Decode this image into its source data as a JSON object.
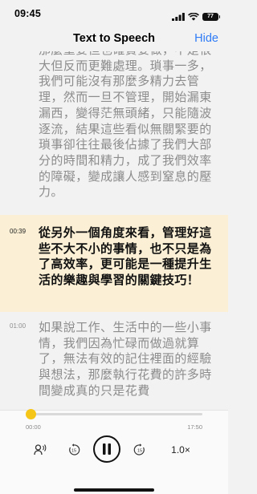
{
  "status": {
    "time": "09:45",
    "battery": "77"
  },
  "header": {
    "title": "Text to Speech",
    "hide_label": "Hide"
  },
  "segments": [
    {
      "time": "",
      "text": "那麼重要但也確實要做，不是很大但反而更難處理。瑣事一多，我們可能沒有那麼多精力去管理，然而一旦不管理，開始漏東漏西，變得茫無頭緒，只能隨波逐流，結果這些看似無關緊要的瑣事卻往往最後佔據了我們大部分的時間和精力，成了我們效率的障礙，變成讓人感到窒息的壓力。",
      "active": false
    },
    {
      "time": "00:39",
      "text": "從另外一個角度來看，管理好這些不大不小的事情，也不只是為了高效率，更可能是一種提升生活的樂趣與學習的關鍵技巧！",
      "active": true
    },
    {
      "time": "01:00",
      "text": "如果說工作、生活中的一些小事情，我們因為忙碌而做過就算了，無法有效的記住裡面的經驗與想法，那麼執行花費的許多時間變成真的只是花費",
      "active": false
    }
  ],
  "player": {
    "current_time": "00:00",
    "total_time": "17:50",
    "progress": 0.0,
    "speed": "1.0×",
    "skip_back_seconds": "15",
    "skip_forward_seconds": "15"
  },
  "colors": {
    "accent": "#2f7cf6",
    "highlight_bg": "#fbf0d5",
    "progress": "#f5c518"
  }
}
